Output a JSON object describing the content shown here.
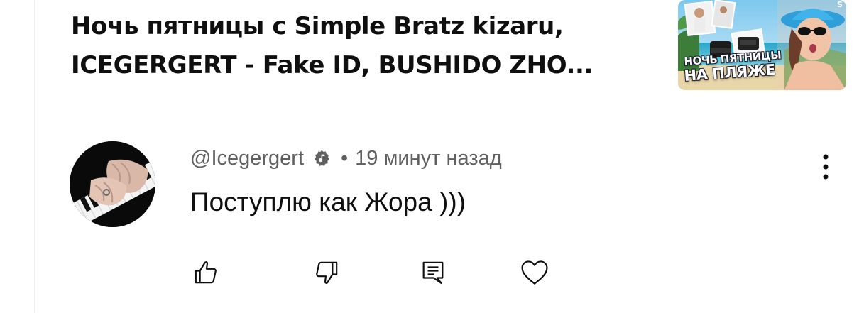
{
  "video": {
    "title_line_1": "Ночь пятницы с Simple Bratz kizaru,",
    "title_line_2": "ICEGERGERT - Fake ID, BUSHIDO ZHO...",
    "thumbnail": {
      "caption_line_1": "НОЧЬ ПЯТНИЦЫ",
      "caption_line_2": "НА ПЛЯЖЕ"
    }
  },
  "comment": {
    "author": "@Icegergert",
    "verified_icon": "verified-music-icon",
    "separator": "•",
    "time": "19 минут назад",
    "text": "Поступлю как Жора )))",
    "avatar_icon": "avatar-piano-hands"
  },
  "actions": {
    "like_icon": "thumb-up-icon",
    "dislike_icon": "thumb-down-icon",
    "reply_icon": "reply-comment-icon",
    "heart_icon": "heart-icon",
    "more_icon": "more-vertical-icon"
  },
  "colors": {
    "primary_text": "#0f0f0f",
    "secondary_text": "#606060",
    "background": "#ffffff"
  }
}
